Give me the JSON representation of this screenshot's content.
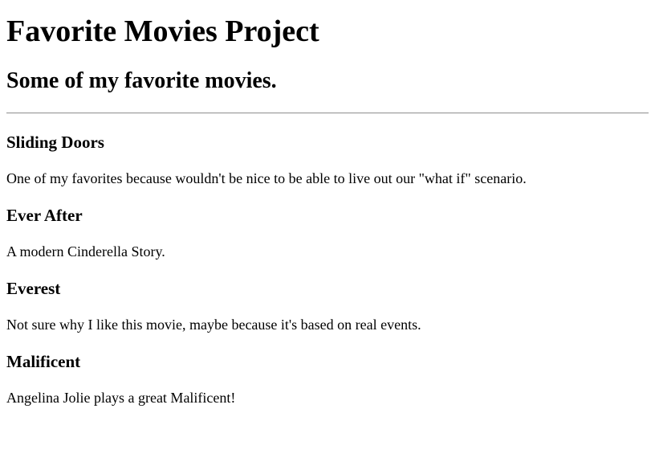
{
  "page": {
    "title": "Favorite Movies Project",
    "subtitle": "Some of my favorite movies."
  },
  "movies": [
    {
      "title": "Sliding Doors",
      "description": "One of my favorites because wouldn't be nice to be able to live out our \"what if\" scenario."
    },
    {
      "title": "Ever After",
      "description": "A modern Cinderella Story."
    },
    {
      "title": "Everest",
      "description": "Not sure why I like this movie, maybe because it's based on real events."
    },
    {
      "title": "Malificent",
      "description": "Angelina Jolie plays a great Malificent!"
    }
  ]
}
